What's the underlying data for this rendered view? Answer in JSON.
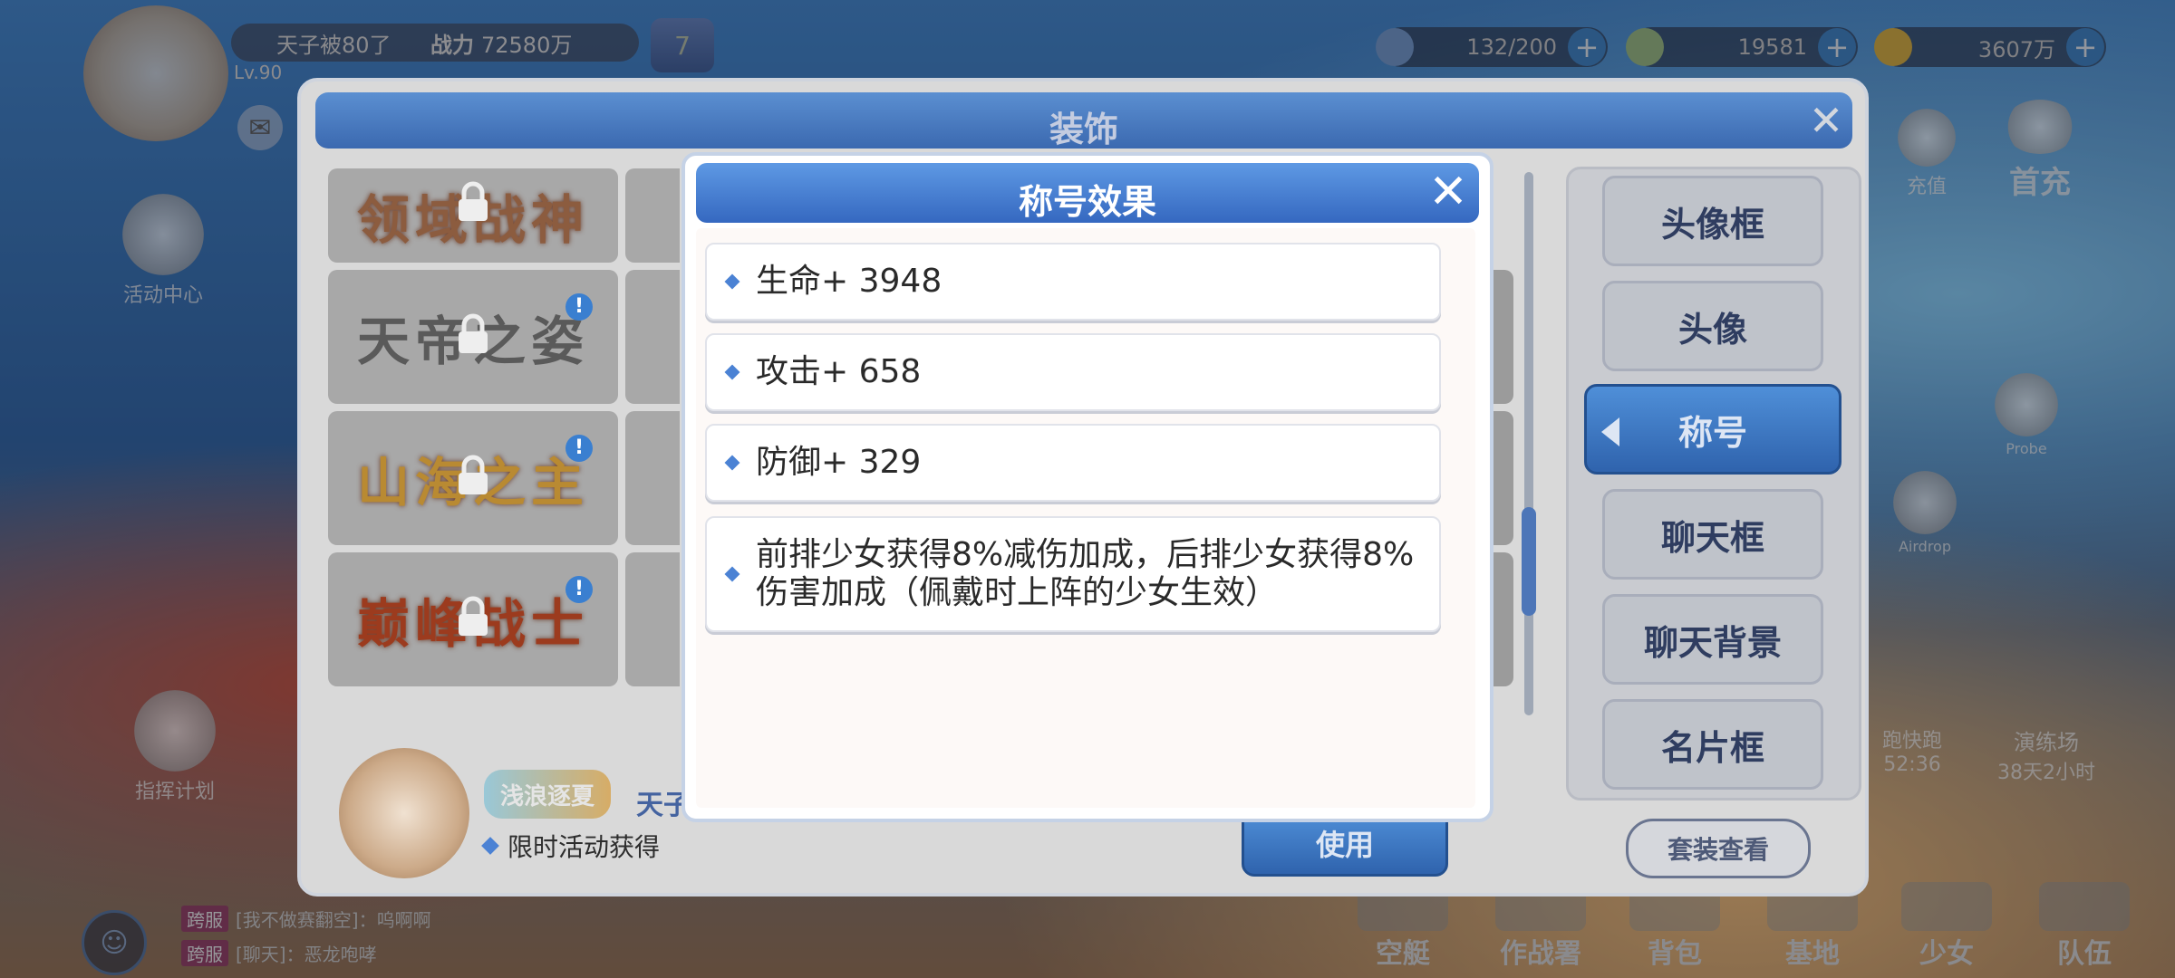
{
  "hud": {
    "player_name": "天子被80了",
    "level": "Lv.90",
    "power_label": "战力",
    "power_value": "72580万",
    "rank": "7",
    "stamina": "132/200",
    "gems": "19581",
    "gold": "3607万"
  },
  "side": {
    "activity_center": "活动中心",
    "command_plan": "指挥计划",
    "recharge": "充值",
    "first_recharge": "首充",
    "probe_label": "Probe",
    "airdrop_label": "Airdrop",
    "express_timer": "52:36",
    "express_label": "跑快跑",
    "training_label": "演练场",
    "training_timer": "38天2小时"
  },
  "bottom_tabs": [
    "空艇",
    "作战署",
    "背包",
    "基地",
    "少女",
    "队伍"
  ],
  "chat": [
    {
      "tag": "跨服",
      "text": "[我不做赛翻空]：呜啊啊"
    },
    {
      "tag": "跨服",
      "text": "[聊天]：恶龙咆哮"
    }
  ],
  "window": {
    "title": "装饰",
    "tabs": [
      "头像框",
      "头像",
      "称号",
      "聊天框",
      "聊天背景",
      "名片框"
    ],
    "active_tab": "称号",
    "set_view_button": "套装查看",
    "use_button": "使用",
    "selected_title_art": "浅浪逐夏",
    "player_name": "天子",
    "source": "限时活动获得",
    "title_cards": [
      "领域战神",
      "天帝之姿",
      "山海之主",
      "巅峰战士"
    ]
  },
  "popup": {
    "title": "称号效果",
    "effects": [
      "生命+ 3948",
      "攻击+ 658",
      "防御+ 329",
      "前排少女获得8%减伤加成，后排少女获得8%伤害加成（佩戴时上阵的少女生效）"
    ]
  },
  "colors": {
    "accent_blue": "#3b69b0",
    "popup_header": "#4f86d4",
    "diamond": "#4b82d4"
  }
}
